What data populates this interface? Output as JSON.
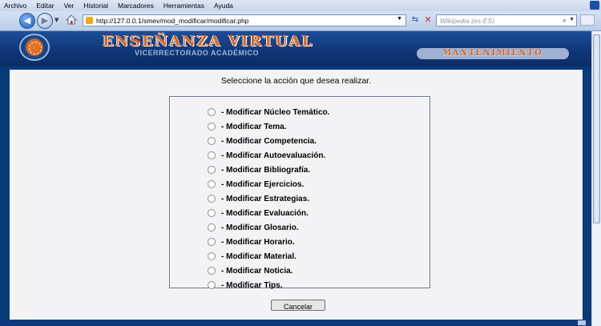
{
  "browser": {
    "menu": [
      "Archivo",
      "Editar",
      "Ver",
      "Historial",
      "Marcadores",
      "Herramientas",
      "Ayuda"
    ],
    "url": "http://127.0.0.1/smev/mod_modificar/modificar.php",
    "search_placeholder": "Wikipedia (es-ES)"
  },
  "banner": {
    "title": "ENSEÑANZA VIRTUAL",
    "subtitle": "VICERRECTORADO ACADÉMICO",
    "section": "MANTENIMIENTO"
  },
  "main": {
    "prompt": "Seleccione la acción que desea realizar.",
    "options": [
      "- Modificar Núcleo Temático.",
      "- Modificar Tema.",
      "- Modificar Competencia.",
      "- Modificar Autoevaluación.",
      "- Modificar Bibliografía.",
      "- Modificar Ejercicios.",
      "- Modificar Estrategias.",
      "- Modificar Evaluación.",
      "- Modificar Glosario.",
      "- Modificar Horario.",
      "- Modificar Material.",
      "- Modificar Noticia.",
      "- Modificar Tips."
    ],
    "cancel_label": "Cancelar"
  }
}
